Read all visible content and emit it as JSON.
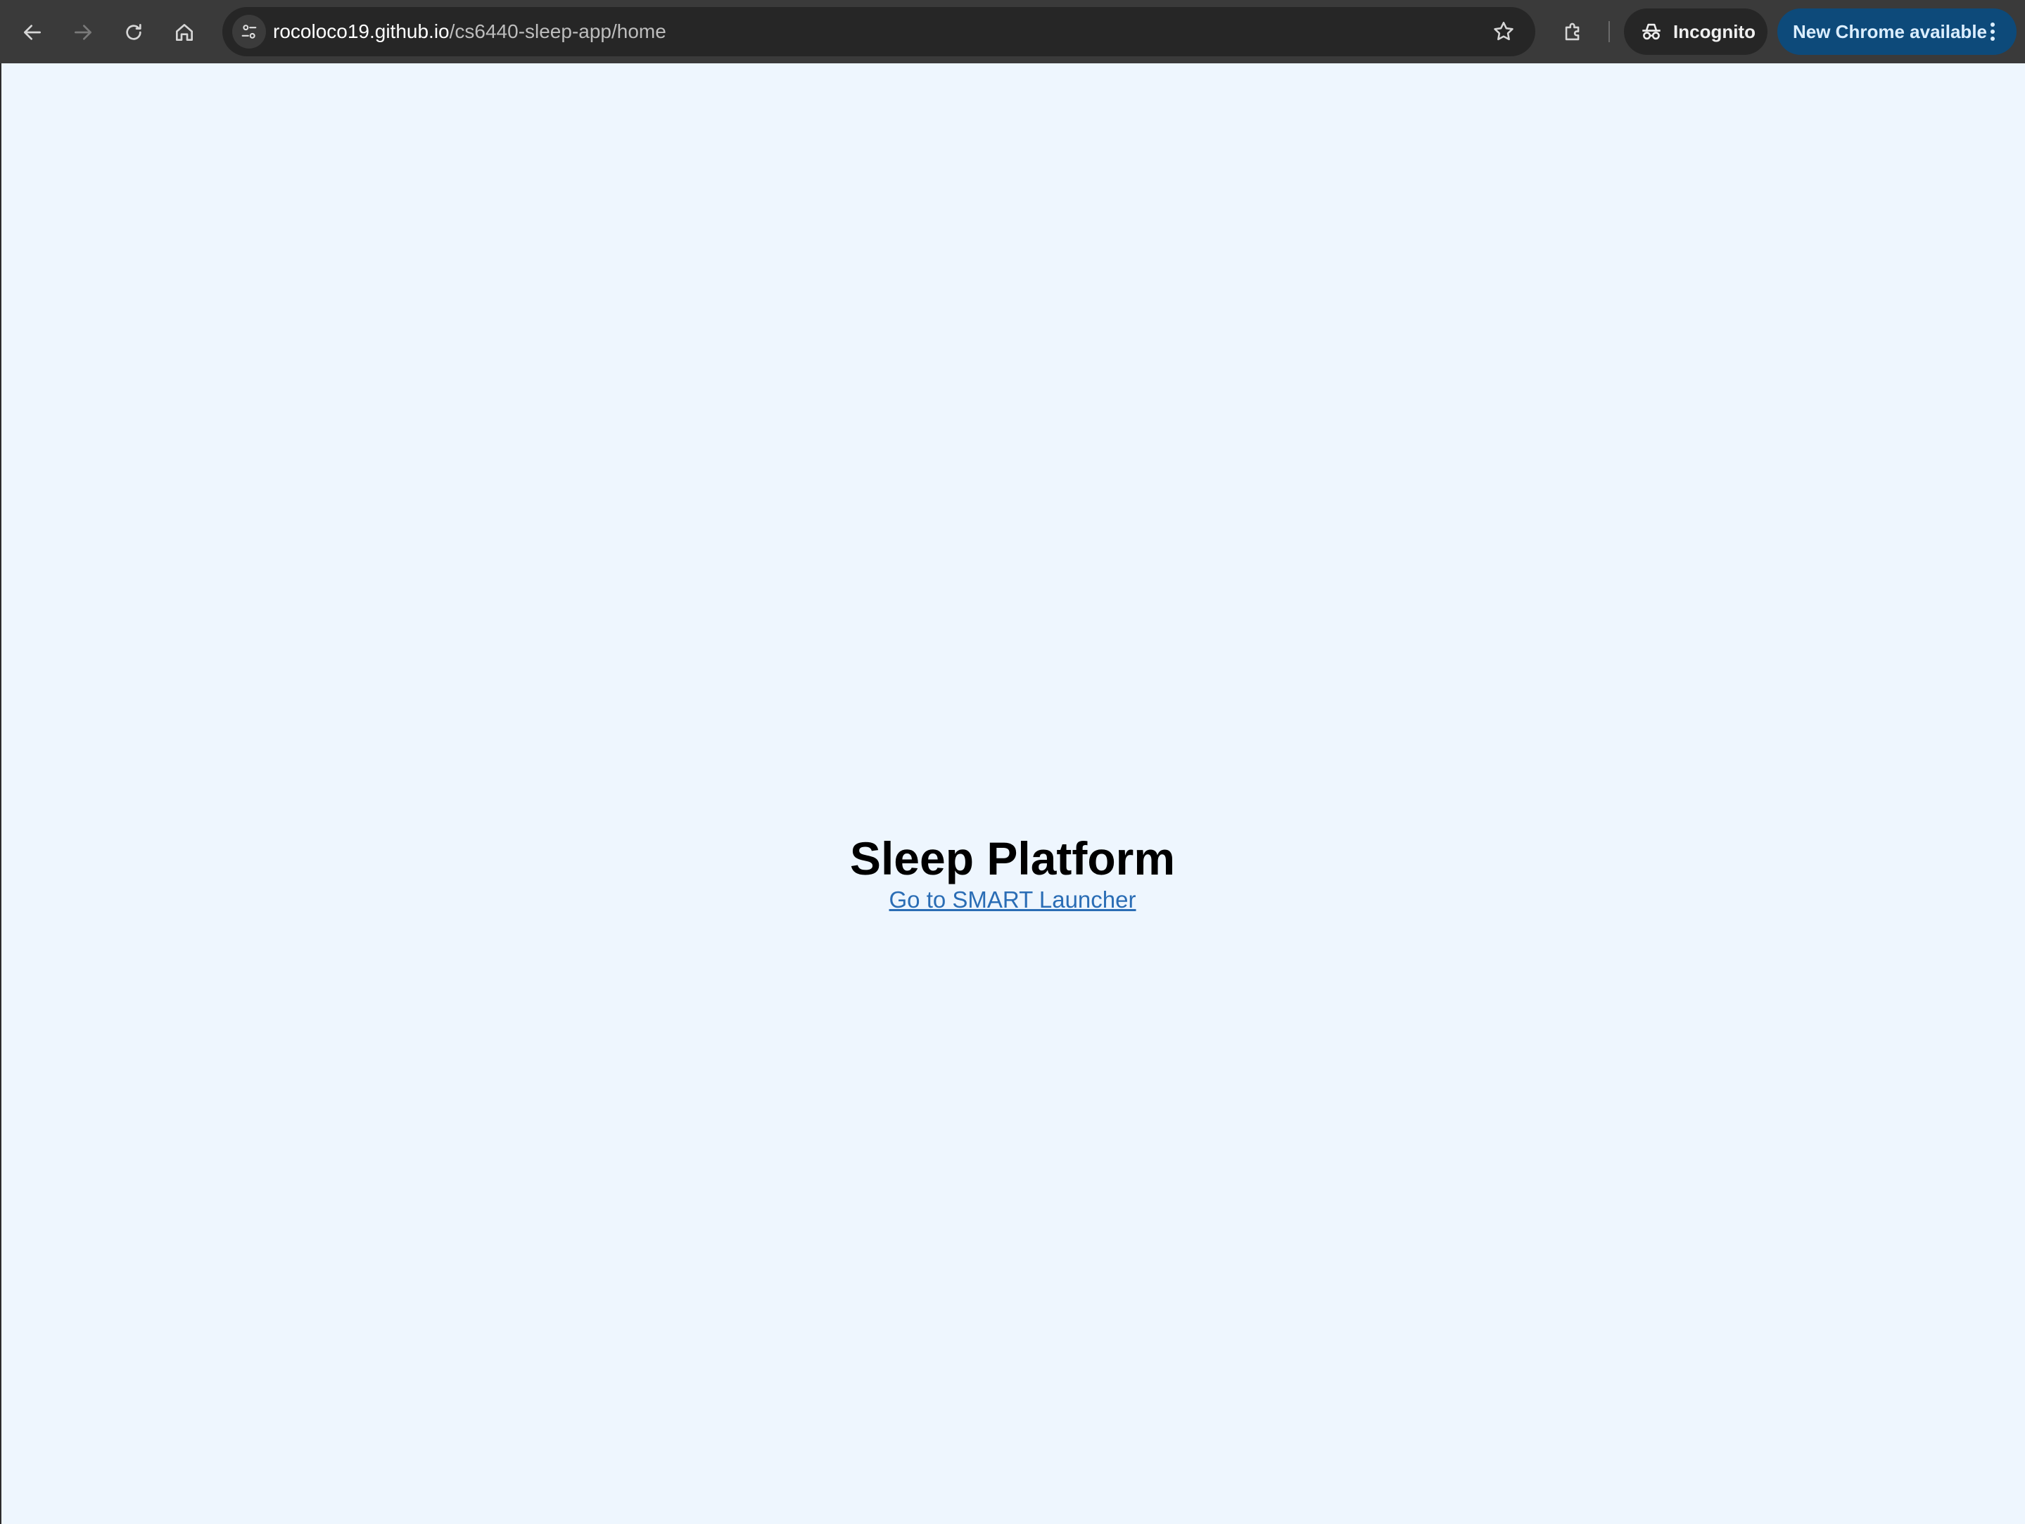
{
  "browser": {
    "url_host": "rocoloco19.github.io",
    "url_path": "/cs6440-sleep-app/home",
    "incognito_label": "Incognito",
    "update_label": "New Chrome available",
    "icons": {
      "back": "arrow-left-icon",
      "forward": "arrow-right-icon",
      "reload": "reload-icon",
      "home": "home-icon",
      "site_info": "tune-icon",
      "bookmark": "star-icon",
      "extensions": "puzzle-icon",
      "incognito": "incognito-icon",
      "menu": "kebab-menu-icon"
    }
  },
  "page": {
    "title": "Sleep Platform",
    "link_text": "Go to SMART Launcher",
    "background": "#eef6fe",
    "link_color": "#2a6db5"
  }
}
